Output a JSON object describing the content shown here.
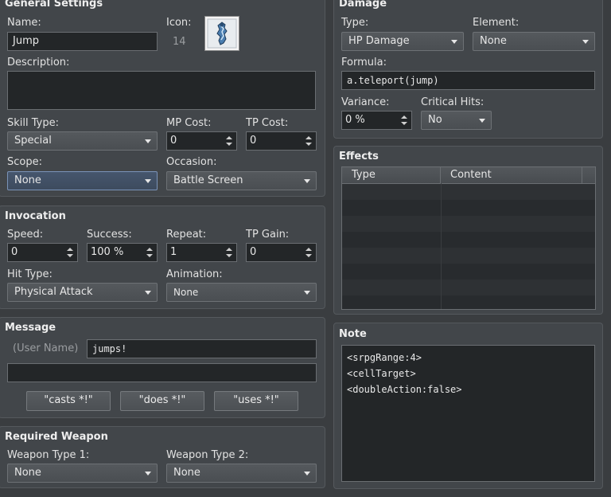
{
  "general": {
    "title": "General Settings",
    "name_label": "Name:",
    "name_value": "Jump",
    "icon_label": "Icon:",
    "icon_index": "14",
    "description_label": "Description:",
    "description_value": "",
    "skill_type_label": "Skill Type:",
    "skill_type_value": "Special",
    "mp_cost_label": "MP Cost:",
    "mp_cost_value": "0",
    "tp_cost_label": "TP Cost:",
    "tp_cost_value": "0",
    "scope_label": "Scope:",
    "scope_value": "None",
    "occasion_label": "Occasion:",
    "occasion_value": "Battle Screen"
  },
  "invocation": {
    "title": "Invocation",
    "speed_label": "Speed:",
    "speed_value": "0",
    "success_label": "Success:",
    "success_value": "100 %",
    "repeat_label": "Repeat:",
    "repeat_value": "1",
    "tp_gain_label": "TP Gain:",
    "tp_gain_value": "0",
    "hit_type_label": "Hit Type:",
    "hit_type_value": "Physical Attack",
    "animation_label": "Animation:",
    "animation_value": "None"
  },
  "message": {
    "title": "Message",
    "user_name_label": "(User Name)",
    "line1_value": "jumps!",
    "line2_value": "",
    "casts_button": "\"casts *!\"",
    "does_button": "\"does *!\"",
    "uses_button": "\"uses *!\""
  },
  "required_weapon": {
    "title": "Required Weapon",
    "type1_label": "Weapon Type 1:",
    "type1_value": "None",
    "type2_label": "Weapon Type 2:",
    "type2_value": "None"
  },
  "damage": {
    "title": "Damage",
    "type_label": "Type:",
    "type_value": "HP Damage",
    "element_label": "Element:",
    "element_value": "None",
    "formula_label": "Formula:",
    "formula_value": "a.teleport(jump)",
    "variance_label": "Variance:",
    "variance_value": "0 %",
    "critical_label": "Critical Hits:",
    "critical_value": "No"
  },
  "effects": {
    "title": "Effects",
    "col_type": "Type",
    "col_content": "Content"
  },
  "note": {
    "title": "Note",
    "line1": "<srpgRange:4>",
    "line2": "<cellTarget>",
    "line3": "<doubleAction:false>"
  }
}
